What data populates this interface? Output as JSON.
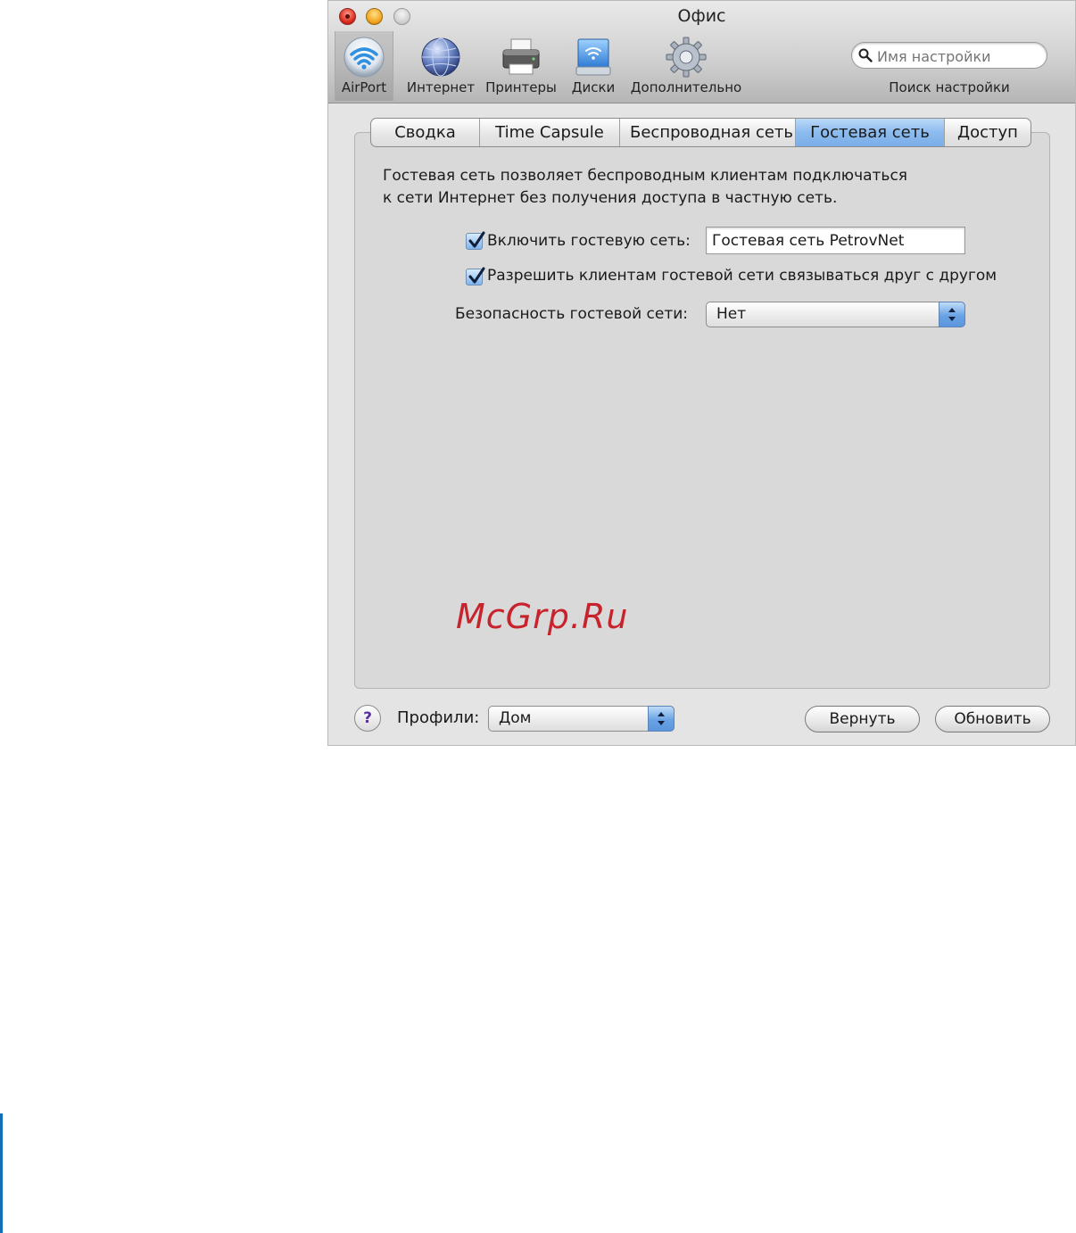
{
  "window": {
    "title": "Офис"
  },
  "toolbar": {
    "items": [
      {
        "label": "AirPort",
        "icon": "wifi-icon",
        "selected": true
      },
      {
        "label": "Интернет",
        "icon": "globe-icon"
      },
      {
        "label": "Принтеры",
        "icon": "printer-icon"
      },
      {
        "label": "Диски",
        "icon": "disk-icon"
      },
      {
        "label": "Дополнительно",
        "icon": "gear-icon"
      }
    ],
    "search": {
      "placeholder": "Имя настройки",
      "caption": "Поиск настройки"
    }
  },
  "tabs": [
    {
      "label": "Сводка",
      "active": false
    },
    {
      "label": "Time Capsule",
      "active": false
    },
    {
      "label": "Беспроводная сеть",
      "active": false
    },
    {
      "label": "Гостевая сеть",
      "active": true
    },
    {
      "label": "Доступ",
      "active": false
    }
  ],
  "guest": {
    "description": [
      "Гостевая сеть позволяет беспроводным клиентам подключаться",
      "к сети Интернет без получения доступа в частную сеть."
    ],
    "enable_label": "Включить гостевую сеть:",
    "enable_checked": true,
    "network_name": "Гостевая сеть PetrovNet",
    "allow_label": "Разрешить клиентам гостевой сети связываться друг с другом",
    "allow_checked": true,
    "security_label": "Безопасность гостевой сети:",
    "security_value": "Нет"
  },
  "footer": {
    "help_symbol": "?",
    "profiles_label": "Профили:",
    "profile_value": "Дом",
    "revert_label": "Вернуть",
    "update_label": "Обновить"
  },
  "watermark": "McGrp.Ru",
  "colors": {
    "accent_blue": "#7aaee8",
    "watermark_red": "#c8232c",
    "close_red": "#d8281a",
    "minimize_yellow": "#f1a21a"
  }
}
